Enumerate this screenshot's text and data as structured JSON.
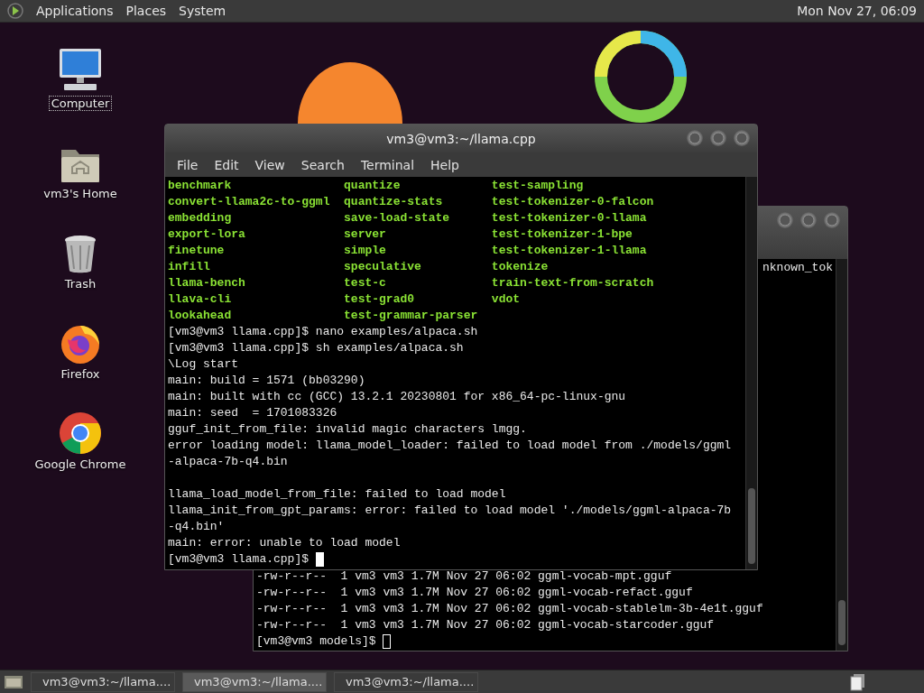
{
  "top_panel": {
    "menus": [
      "Applications",
      "Places",
      "System"
    ],
    "clock": "Mon Nov 27, 06:09"
  },
  "desktop_icons": [
    {
      "label": "Computer",
      "kind": "computer",
      "selected": true
    },
    {
      "label": "vm3's Home",
      "kind": "home",
      "selected": false
    },
    {
      "label": "Trash",
      "kind": "trash",
      "selected": false
    },
    {
      "label": "Firefox",
      "kind": "firefox",
      "selected": false
    },
    {
      "label": "Google Chrome",
      "kind": "chrome",
      "selected": false
    }
  ],
  "back_window": {
    "focused": false,
    "top_lines": [
      "nknown_tok"
    ],
    "bottom_lines": [
      "-rw-r--r--  1 vm3 vm3 1.7M Nov 27 06:02 ggml-vocab-mpt.gguf",
      "-rw-r--r--  1 vm3 vm3 1.7M Nov 27 06:02 ggml-vocab-refact.gguf",
      "-rw-r--r--  1 vm3 vm3 1.7M Nov 27 06:02 ggml-vocab-stablelm-3b-4e1t.gguf",
      "-rw-r--r--  1 vm3 vm3 1.7M Nov 27 06:02 ggml-vocab-starcoder.gguf"
    ],
    "prompt": "[vm3@vm3 models]$"
  },
  "front_window": {
    "focused": true,
    "title": "vm3@vm3:~/llama.cpp",
    "menu": [
      "File",
      "Edit",
      "View",
      "Search",
      "Terminal",
      "Help"
    ],
    "listing": [
      [
        "benchmark",
        "quantize",
        "test-sampling"
      ],
      [
        "convert-llama2c-to-ggml",
        "quantize-stats",
        "test-tokenizer-0-falcon"
      ],
      [
        "embedding",
        "save-load-state",
        "test-tokenizer-0-llama"
      ],
      [
        "export-lora",
        "server",
        "test-tokenizer-1-bpe"
      ],
      [
        "finetune",
        "simple",
        "test-tokenizer-1-llama"
      ],
      [
        "infill",
        "speculative",
        "tokenize"
      ],
      [
        "llama-bench",
        "test-c",
        "train-text-from-scratch"
      ],
      [
        "llava-cli",
        "test-grad0",
        "vdot"
      ],
      [
        "lookahead",
        "test-grammar-parser"
      ]
    ],
    "lines": [
      {
        "kind": "command",
        "text": "[vm3@vm3 llama.cpp]$ nano examples/alpaca.sh"
      },
      {
        "kind": "command",
        "text": "[vm3@vm3 llama.cpp]$ sh examples/alpaca.sh"
      },
      {
        "kind": "output",
        "text": "\\Log start"
      },
      {
        "kind": "output",
        "text": "main: build = 1571 (bb03290)"
      },
      {
        "kind": "output",
        "text": "main: built with cc (GCC) 13.2.1 20230801 for x86_64-pc-linux-gnu"
      },
      {
        "kind": "output",
        "text": "main: seed  = 1701083326"
      },
      {
        "kind": "output",
        "text": "gguf_init_from_file: invalid magic characters lmgg."
      },
      {
        "kind": "output",
        "text": "error loading model: llama_model_loader: failed to load model from ./models/ggml"
      },
      {
        "kind": "output",
        "text": "-alpaca-7b-q4.bin"
      },
      {
        "kind": "blank"
      },
      {
        "kind": "output",
        "text": "llama_load_model_from_file: failed to load model"
      },
      {
        "kind": "output",
        "text": "llama_init_from_gpt_params: error: failed to load model './models/ggml-alpaca-7b"
      },
      {
        "kind": "output",
        "text": "-q4.bin'"
      },
      {
        "kind": "output",
        "text": "main: error: unable to load model"
      }
    ],
    "prompt": "[vm3@vm3 llama.cpp]$"
  },
  "taskbar": {
    "tasks": [
      {
        "label": "vm3@vm3:~/llama....",
        "selected": false
      },
      {
        "label": "vm3@vm3:~/llama....",
        "selected": true
      },
      {
        "label": "vm3@vm3:~/llama....",
        "selected": false
      }
    ]
  }
}
